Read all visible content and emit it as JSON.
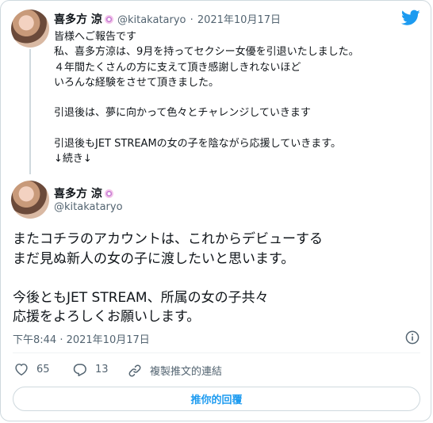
{
  "quoted": {
    "author_name": "喜多方 涼",
    "author_handle": "@kitakataryo",
    "separator": "·",
    "date": "2021年10月17日",
    "lines": [
      "皆様へご報告です",
      "私、喜多方涼は、9月を持ってセクシー女優を引退いたしました。",
      "４年間たくさんの方に支えて頂き感謝しきれないほど",
      "いろんな経験をさせて頂きました。",
      "",
      "引退後は、夢に向かって色々とチャレンジしていきます",
      "",
      "引退後もJET STREAMの女の子を陰ながら応援していきます。",
      "↓続き↓"
    ]
  },
  "main": {
    "author_name": "喜多方 涼",
    "author_handle": "@kitakataryo",
    "lines": [
      "またコチラのアカウントは、これからデビューする",
      "まだ見ぬ新人の女の子に渡したいと思います。",
      "",
      "今後ともJET STREAM、所属の女の子共々",
      "応援をよろしくお願いします。"
    ],
    "timestamp": "下午8:44 · 2021年10月17日"
  },
  "actions": {
    "likes": "65",
    "replies": "13",
    "copy_link": "複製推文的連結"
  },
  "reply_button": "推你的回覆",
  "icons": {
    "brand": "twitter-bird-icon",
    "like": "heart-icon",
    "reply": "reply-icon",
    "copy": "link-icon",
    "info": "info-icon"
  },
  "colors": {
    "accent": "#1d9bf0",
    "text": "#0f1419",
    "muted": "#536471",
    "border": "#cfd9de"
  }
}
